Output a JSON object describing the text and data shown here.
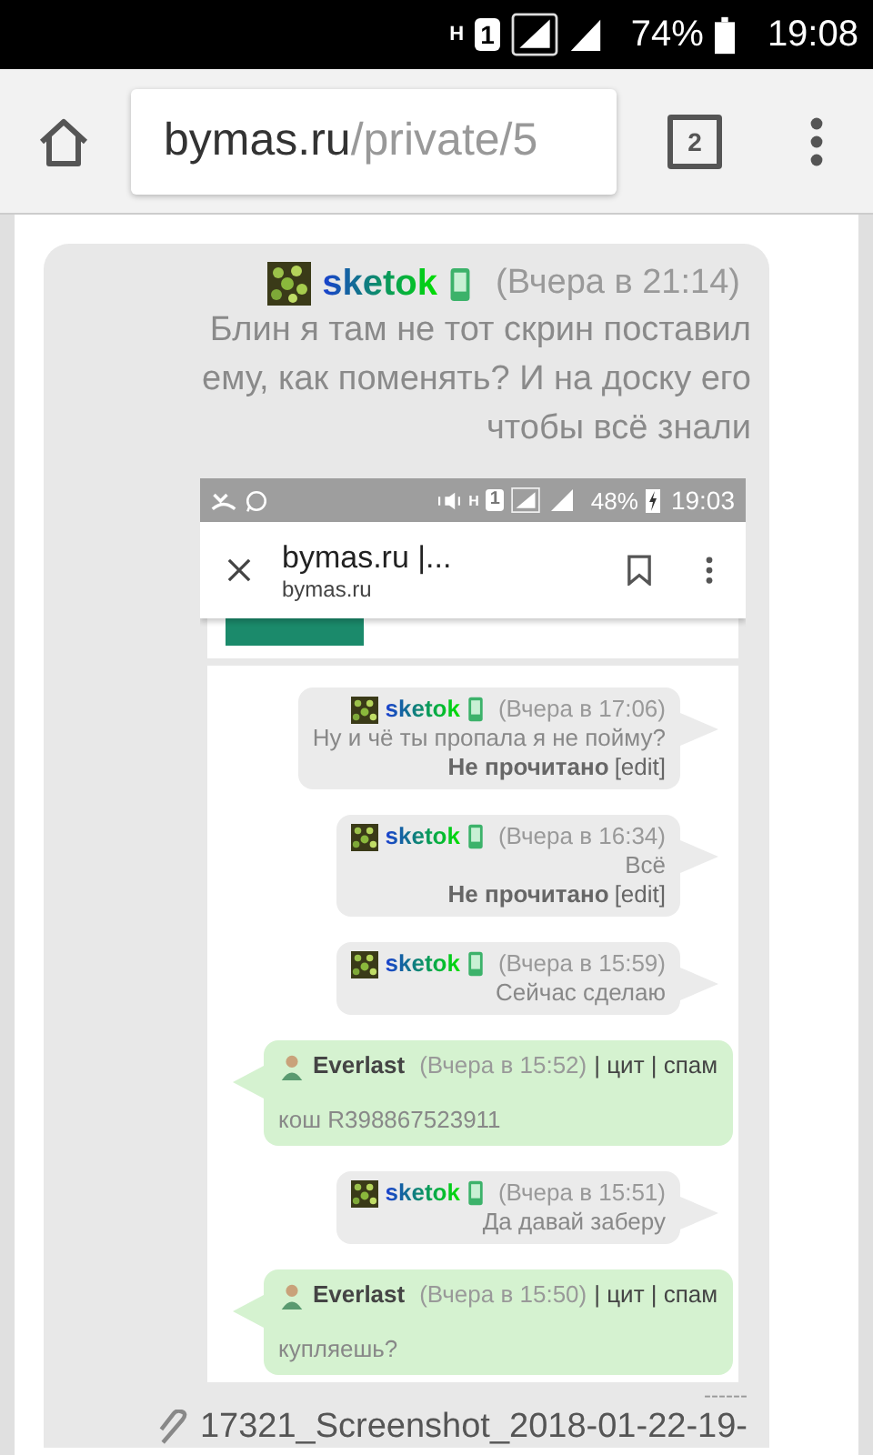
{
  "status_bar": {
    "network": "H",
    "sim": "1",
    "battery": "74%",
    "time": "19:08"
  },
  "browser": {
    "url_host": "bymas.ru",
    "url_path": "/private/5",
    "tab_count": "2"
  },
  "message": {
    "author": "sketok",
    "time": "(Вчера в 21:14)",
    "text": "Блин я там не тот скрин поставил ему, как поменять? И на доску его чтобы всё знали",
    "screenshot": {
      "status_bar": {
        "network": "H",
        "sim": "1",
        "battery": "48%",
        "charging": true,
        "time": "19:03"
      },
      "tab": {
        "title": "bymas.ru |...",
        "host": "bymas.ru"
      },
      "messages": [
        {
          "kind": "mine",
          "author": "sketok",
          "time": "(Вчера в 17:06)",
          "text": "Ну и чё ты пропала я не пойму?",
          "status": "Не прочитано",
          "edit": "[edit]"
        },
        {
          "kind": "mine",
          "author": "sketok",
          "time": "(Вчера в 16:34)",
          "text": "Всё",
          "status": "Не прочитано",
          "edit": "[edit]"
        },
        {
          "kind": "mine",
          "author": "sketok",
          "time": "(Вчера в 15:59)",
          "text": "Сейчас сделаю"
        },
        {
          "kind": "theirs",
          "author": "Everlast",
          "time": "(Вчера в 15:52)",
          "actions": "| цит | спам",
          "text": "кош R398867523911"
        },
        {
          "kind": "mine",
          "author": "sketok",
          "time": "(Вчера в 15:51)",
          "text": "Да давай заберу"
        },
        {
          "kind": "theirs",
          "author": "Everlast",
          "time": "(Вчера в 15:50)",
          "actions": "| цит | спам",
          "text": "купляешь?"
        }
      ]
    },
    "divider": "------",
    "attachment": "17321_Screenshot_2018-01-22-19-"
  }
}
